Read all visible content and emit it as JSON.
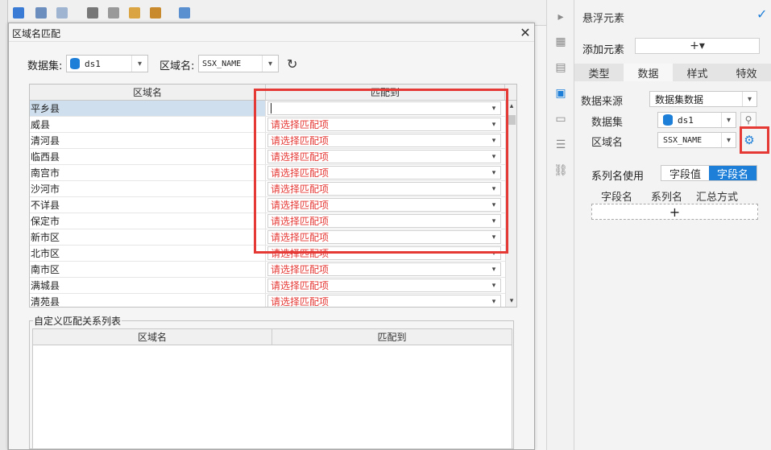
{
  "editor": {
    "title_bar_text": "…"
  },
  "right_panel": {
    "title": "悬浮元素",
    "add_element_label": "添加元素",
    "add_element_button": "+▾",
    "tabs": [
      "类型",
      "数据",
      "样式",
      "特效"
    ],
    "selected_tab": "数据",
    "data_source_label": "数据来源",
    "data_source_value": "数据集数据",
    "dataset_label": "数据集",
    "dataset_value": "ds1",
    "region_label": "区域名",
    "region_value": "SSX_NAME",
    "series_name_label": "系列名使用",
    "series_options": [
      "字段值",
      "字段名"
    ],
    "series_selected": "字段名",
    "field_headers": [
      "字段名",
      "系列名",
      "汇总方式"
    ],
    "add_field_button": "+"
  },
  "dialog": {
    "title": "区域名匹配",
    "close": "✕",
    "dataset_label": "数据集:",
    "dataset_value": "ds1",
    "region_label": "区域名:",
    "region_value": "SSX_NAME",
    "table_headers": [
      "区域名",
      "匹配到"
    ],
    "rows": [
      {
        "name": "平乡县",
        "match": ""
      },
      {
        "name": "威县",
        "match": "请选择匹配项"
      },
      {
        "name": "清河县",
        "match": "请选择匹配项"
      },
      {
        "name": "临西县",
        "match": "请选择匹配项"
      },
      {
        "name": "南宫市",
        "match": "请选择匹配项"
      },
      {
        "name": "沙河市",
        "match": "请选择匹配项"
      },
      {
        "name": "不详县",
        "match": "请选择匹配项"
      },
      {
        "name": "保定市",
        "match": "请选择匹配项"
      },
      {
        "name": "新市区",
        "match": "请选择匹配项"
      },
      {
        "name": "北市区",
        "match": "请选择匹配项"
      },
      {
        "name": "南市区",
        "match": "请选择匹配项"
      },
      {
        "name": "满城县",
        "match": "请选择匹配项"
      },
      {
        "name": "清苑县",
        "match": "请选择匹配项"
      }
    ],
    "custom_section_title": "自定义匹配关系列表",
    "custom_headers": [
      "区域名",
      "匹配到"
    ]
  },
  "colors": {
    "accent": "#1e7fd8",
    "highlight": "#e53935",
    "placeholder_text": "#e53935"
  }
}
